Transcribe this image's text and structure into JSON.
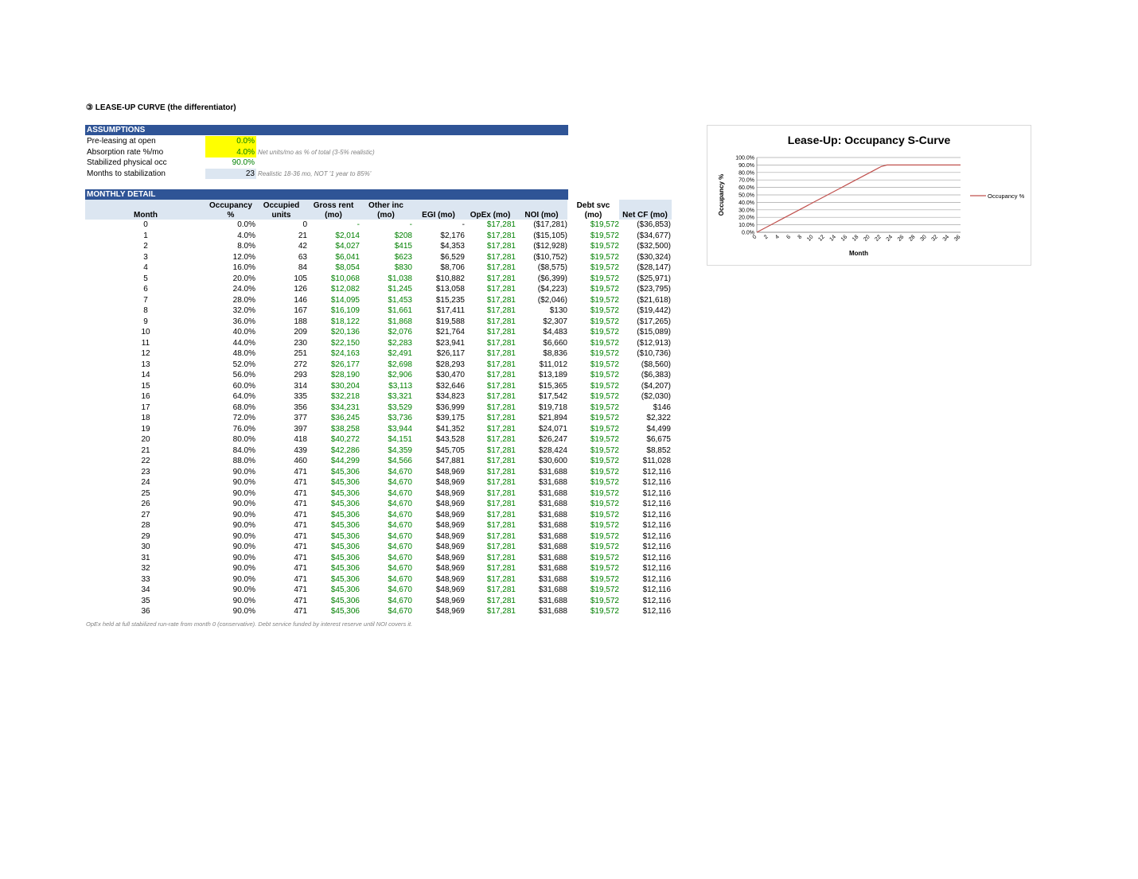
{
  "title": "③  LEASE-UP CURVE  (the differentiator)",
  "assumptions": {
    "header": "ASSUMPTIONS",
    "rows": [
      {
        "label": "Pre-leasing at open",
        "value": "0.0%",
        "note": ""
      },
      {
        "label": "Absorption rate %/mo",
        "value": "4.0%",
        "note": "Net units/mo as % of total (3-5% realistic)"
      },
      {
        "label": "Stabilized physical occ",
        "value": "90.0%",
        "note": ""
      },
      {
        "label": "Months to stabilization",
        "value": "23",
        "note": "Realistic 18-36 mo, NOT '1 year to 85%'"
      }
    ]
  },
  "detail": {
    "header": "MONTHLY DETAIL",
    "columns": [
      {
        "l1": "",
        "l2": "Month"
      },
      {
        "l1": "Occupancy",
        "l2": "%"
      },
      {
        "l1": "Occupied",
        "l2": "units"
      },
      {
        "l1": "Gross rent",
        "l2": "(mo)"
      },
      {
        "l1": "Other inc",
        "l2": "(mo)"
      },
      {
        "l1": "",
        "l2": "EGI (mo)"
      },
      {
        "l1": "",
        "l2": "OpEx (mo)"
      },
      {
        "l1": "",
        "l2": "NOI (mo)"
      },
      {
        "l1": "Debt svc",
        "l2": "(mo)"
      },
      {
        "l1": "",
        "l2": "Net CF (mo)"
      }
    ],
    "rows": [
      [
        "0",
        "0.0%",
        "0",
        "-",
        "-",
        "-",
        "$17,281",
        "($17,281)",
        "$19,572",
        "($36,853)"
      ],
      [
        "1",
        "4.0%",
        "21",
        "$2,014",
        "$208",
        "$2,176",
        "$17,281",
        "($15,105)",
        "$19,572",
        "($34,677)"
      ],
      [
        "2",
        "8.0%",
        "42",
        "$4,027",
        "$415",
        "$4,353",
        "$17,281",
        "($12,928)",
        "$19,572",
        "($32,500)"
      ],
      [
        "3",
        "12.0%",
        "63",
        "$6,041",
        "$623",
        "$6,529",
        "$17,281",
        "($10,752)",
        "$19,572",
        "($30,324)"
      ],
      [
        "4",
        "16.0%",
        "84",
        "$8,054",
        "$830",
        "$8,706",
        "$17,281",
        "($8,575)",
        "$19,572",
        "($28,147)"
      ],
      [
        "5",
        "20.0%",
        "105",
        "$10,068",
        "$1,038",
        "$10,882",
        "$17,281",
        "($6,399)",
        "$19,572",
        "($25,971)"
      ],
      [
        "6",
        "24.0%",
        "126",
        "$12,082",
        "$1,245",
        "$13,058",
        "$17,281",
        "($4,223)",
        "$19,572",
        "($23,795)"
      ],
      [
        "7",
        "28.0%",
        "146",
        "$14,095",
        "$1,453",
        "$15,235",
        "$17,281",
        "($2,046)",
        "$19,572",
        "($21,618)"
      ],
      [
        "8",
        "32.0%",
        "167",
        "$16,109",
        "$1,661",
        "$17,411",
        "$17,281",
        "$130",
        "$19,572",
        "($19,442)"
      ],
      [
        "9",
        "36.0%",
        "188",
        "$18,122",
        "$1,868",
        "$19,588",
        "$17,281",
        "$2,307",
        "$19,572",
        "($17,265)"
      ],
      [
        "10",
        "40.0%",
        "209",
        "$20,136",
        "$2,076",
        "$21,764",
        "$17,281",
        "$4,483",
        "$19,572",
        "($15,089)"
      ],
      [
        "11",
        "44.0%",
        "230",
        "$22,150",
        "$2,283",
        "$23,941",
        "$17,281",
        "$6,660",
        "$19,572",
        "($12,913)"
      ],
      [
        "12",
        "48.0%",
        "251",
        "$24,163",
        "$2,491",
        "$26,117",
        "$17,281",
        "$8,836",
        "$19,572",
        "($10,736)"
      ],
      [
        "13",
        "52.0%",
        "272",
        "$26,177",
        "$2,698",
        "$28,293",
        "$17,281",
        "$11,012",
        "$19,572",
        "($8,560)"
      ],
      [
        "14",
        "56.0%",
        "293",
        "$28,190",
        "$2,906",
        "$30,470",
        "$17,281",
        "$13,189",
        "$19,572",
        "($6,383)"
      ],
      [
        "15",
        "60.0%",
        "314",
        "$30,204",
        "$3,113",
        "$32,646",
        "$17,281",
        "$15,365",
        "$19,572",
        "($4,207)"
      ],
      [
        "16",
        "64.0%",
        "335",
        "$32,218",
        "$3,321",
        "$34,823",
        "$17,281",
        "$17,542",
        "$19,572",
        "($2,030)"
      ],
      [
        "17",
        "68.0%",
        "356",
        "$34,231",
        "$3,529",
        "$36,999",
        "$17,281",
        "$19,718",
        "$19,572",
        "$146"
      ],
      [
        "18",
        "72.0%",
        "377",
        "$36,245",
        "$3,736",
        "$39,175",
        "$17,281",
        "$21,894",
        "$19,572",
        "$2,322"
      ],
      [
        "19",
        "76.0%",
        "397",
        "$38,258",
        "$3,944",
        "$41,352",
        "$17,281",
        "$24,071",
        "$19,572",
        "$4,499"
      ],
      [
        "20",
        "80.0%",
        "418",
        "$40,272",
        "$4,151",
        "$43,528",
        "$17,281",
        "$26,247",
        "$19,572",
        "$6,675"
      ],
      [
        "21",
        "84.0%",
        "439",
        "$42,286",
        "$4,359",
        "$45,705",
        "$17,281",
        "$28,424",
        "$19,572",
        "$8,852"
      ],
      [
        "22",
        "88.0%",
        "460",
        "$44,299",
        "$4,566",
        "$47,881",
        "$17,281",
        "$30,600",
        "$19,572",
        "$11,028"
      ],
      [
        "23",
        "90.0%",
        "471",
        "$45,306",
        "$4,670",
        "$48,969",
        "$17,281",
        "$31,688",
        "$19,572",
        "$12,116"
      ],
      [
        "24",
        "90.0%",
        "471",
        "$45,306",
        "$4,670",
        "$48,969",
        "$17,281",
        "$31,688",
        "$19,572",
        "$12,116"
      ],
      [
        "25",
        "90.0%",
        "471",
        "$45,306",
        "$4,670",
        "$48,969",
        "$17,281",
        "$31,688",
        "$19,572",
        "$12,116"
      ],
      [
        "26",
        "90.0%",
        "471",
        "$45,306",
        "$4,670",
        "$48,969",
        "$17,281",
        "$31,688",
        "$19,572",
        "$12,116"
      ],
      [
        "27",
        "90.0%",
        "471",
        "$45,306",
        "$4,670",
        "$48,969",
        "$17,281",
        "$31,688",
        "$19,572",
        "$12,116"
      ],
      [
        "28",
        "90.0%",
        "471",
        "$45,306",
        "$4,670",
        "$48,969",
        "$17,281",
        "$31,688",
        "$19,572",
        "$12,116"
      ],
      [
        "29",
        "90.0%",
        "471",
        "$45,306",
        "$4,670",
        "$48,969",
        "$17,281",
        "$31,688",
        "$19,572",
        "$12,116"
      ],
      [
        "30",
        "90.0%",
        "471",
        "$45,306",
        "$4,670",
        "$48,969",
        "$17,281",
        "$31,688",
        "$19,572",
        "$12,116"
      ],
      [
        "31",
        "90.0%",
        "471",
        "$45,306",
        "$4,670",
        "$48,969",
        "$17,281",
        "$31,688",
        "$19,572",
        "$12,116"
      ],
      [
        "32",
        "90.0%",
        "471",
        "$45,306",
        "$4,670",
        "$48,969",
        "$17,281",
        "$31,688",
        "$19,572",
        "$12,116"
      ],
      [
        "33",
        "90.0%",
        "471",
        "$45,306",
        "$4,670",
        "$48,969",
        "$17,281",
        "$31,688",
        "$19,572",
        "$12,116"
      ],
      [
        "34",
        "90.0%",
        "471",
        "$45,306",
        "$4,670",
        "$48,969",
        "$17,281",
        "$31,688",
        "$19,572",
        "$12,116"
      ],
      [
        "35",
        "90.0%",
        "471",
        "$45,306",
        "$4,670",
        "$48,969",
        "$17,281",
        "$31,688",
        "$19,572",
        "$12,116"
      ],
      [
        "36",
        "90.0%",
        "471",
        "$45,306",
        "$4,670",
        "$48,969",
        "$17,281",
        "$31,688",
        "$19,572",
        "$12,116"
      ]
    ],
    "green_columns": [
      3,
      4,
      6,
      8
    ]
  },
  "footnote": "OpEx held at full stabilized run-rate from month 0 (conservative). Debt service funded by interest reserve until NOI covers it.",
  "colors": {
    "header_bg": "#2f5496",
    "subheader_bg": "#dce6f1",
    "input_yellow": "#ffff00",
    "input_green": "#008000",
    "series_line": "#c0504d"
  },
  "chart_data": {
    "type": "line",
    "title": "Lease-Up: Occupancy S-Curve",
    "xlabel": "Month",
    "ylabel": "Occupancy %",
    "xlim": [
      0,
      36
    ],
    "ylim": [
      0,
      100
    ],
    "xticks": [
      "0",
      "2",
      "4",
      "6",
      "8",
      "10",
      "12",
      "14",
      "16",
      "18",
      "20",
      "22",
      "24",
      "26",
      "28",
      "30",
      "32",
      "34",
      "36"
    ],
    "yticks": [
      "0.0%",
      "10.0%",
      "20.0%",
      "30.0%",
      "40.0%",
      "50.0%",
      "60.0%",
      "70.0%",
      "80.0%",
      "90.0%",
      "100.0%"
    ],
    "grid": true,
    "legend": "right",
    "x": [
      0,
      1,
      2,
      3,
      4,
      5,
      6,
      7,
      8,
      9,
      10,
      11,
      12,
      13,
      14,
      15,
      16,
      17,
      18,
      19,
      20,
      21,
      22,
      23,
      24,
      25,
      26,
      27,
      28,
      29,
      30,
      31,
      32,
      33,
      34,
      35,
      36
    ],
    "series": [
      {
        "name": "Occupancy %",
        "values": [
          0,
          4,
          8,
          12,
          16,
          20,
          24,
          28,
          32,
          36,
          40,
          44,
          48,
          52,
          56,
          60,
          64,
          68,
          72,
          76,
          80,
          84,
          88,
          90,
          90,
          90,
          90,
          90,
          90,
          90,
          90,
          90,
          90,
          90,
          90,
          90,
          90
        ]
      }
    ]
  }
}
